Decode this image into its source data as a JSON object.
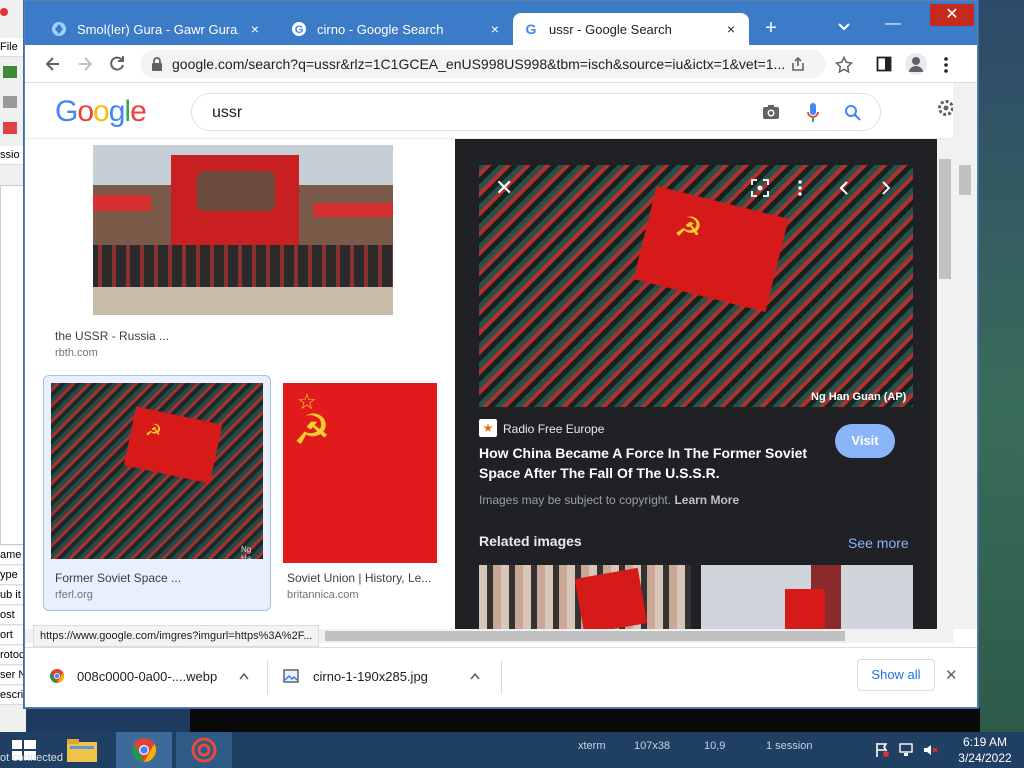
{
  "desktop": {
    "left_labels": [
      "File",
      "ssio",
      "ame",
      "ype",
      "ub it",
      "ost",
      "ort",
      "rotoc",
      "ser N",
      "escri"
    ],
    "status_left": "ot connected"
  },
  "tabs": [
    {
      "title": "Smol(ler) Gura - Gawr Gura, Holo",
      "close": "×"
    },
    {
      "title": "cirno - Google Search",
      "close": "×"
    },
    {
      "title": "ussr - Google Search",
      "close": "×"
    }
  ],
  "window": {
    "new_tab": "+",
    "minimize": "—",
    "close": "✕"
  },
  "toolbar": {
    "url": "google.com/search?q=ussr&rlz=1C1GCEA_enUS998US998&tbm=isch&source=iu&ictx=1&vet=1..."
  },
  "google": {
    "logo_letters": [
      {
        "ch": "G",
        "color": "#4285f4"
      },
      {
        "ch": "o",
        "color": "#ea4335"
      },
      {
        "ch": "o",
        "color": "#fbbc05"
      },
      {
        "ch": "g",
        "color": "#4285f4"
      },
      {
        "ch": "l",
        "color": "#34a853"
      },
      {
        "ch": "e",
        "color": "#ea4335"
      }
    ],
    "query": "ussr"
  },
  "results": [
    {
      "caption": "the USSR - Russia ...",
      "source": "rbth.com"
    },
    {
      "caption": "Former Soviet Space ...",
      "source": "rferl.org",
      "watermark": "Ng Ha"
    },
    {
      "caption": "Soviet Union | History, Le...",
      "source": "britannica.com"
    }
  ],
  "preview": {
    "credit": "Ng Han Guan (AP)",
    "publisher": "Radio Free Europe",
    "title": "How China Became A Force In The Former Soviet Space After The Fall Of The U.S.S.R.",
    "visit": "Visit",
    "copyright": "Images may be subject to copyright.",
    "learn_more": "Learn More",
    "related": "Related images",
    "see_more": "See more"
  },
  "status_url": "https://www.google.com/imgres?imgurl=https%3A%2F...",
  "downloads": [
    {
      "name": "008c0000-0a00-....webp"
    },
    {
      "name": "cirno-1-190x285.jpg"
    }
  ],
  "download_bar": {
    "show_all": "Show all",
    "close": "✕"
  },
  "taskbar": {
    "xterm": "xterm",
    "size": "107x38",
    "pos": "10,9",
    "sessions": "1 session",
    "time": "6:19 AM",
    "date": "3/24/2022"
  },
  "colors": {
    "accent": "#1a73e8",
    "tabbar": "#3c7bc8",
    "visit_button": "#8ab4f8",
    "flag_red": "#d61a1a",
    "hammer_gold": "#f7d02c"
  }
}
